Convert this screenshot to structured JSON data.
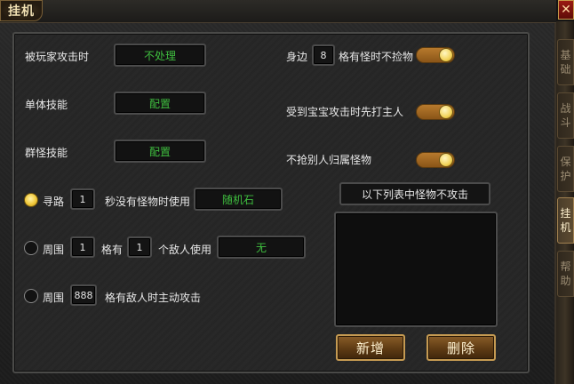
{
  "window": {
    "title": "挂机"
  },
  "settings": {
    "attacked_label": "被玩家攻击时",
    "attacked_value": "不处理",
    "single_skill_label": "单体技能",
    "single_skill_value": "配置",
    "group_skill_label": "群怪技能",
    "group_skill_value": "配置"
  },
  "right_options": {
    "nearby_prefix": "身边",
    "nearby_count": "8",
    "nearby_suffix": "格有怪时不捡物",
    "nearby_toggle": true,
    "pet_attacked_label": "受到宝宝攻击时先打主人",
    "pet_attacked_toggle": true,
    "no_steal_label": "不抢别人归属怪物",
    "no_steal_toggle": true
  },
  "pathfind": {
    "selected": true,
    "label": "寻路",
    "seconds": "1",
    "suffix": "秒没有怪物时使用",
    "item": "随机石"
  },
  "surround": {
    "selected": false,
    "label": "周围",
    "cells": "1",
    "mid": "格有",
    "enemies": "1",
    "suffix": "个敌人使用",
    "item": "无"
  },
  "auto_attack": {
    "selected": false,
    "label": "周围",
    "cells": "888",
    "suffix": "格有敌人时主动攻击"
  },
  "monster_list": {
    "header": "以下列表中怪物不攻击",
    "items": []
  },
  "buttons": {
    "add": "新增",
    "delete": "删除"
  },
  "side_tabs": [
    {
      "label": "基础",
      "chars": [
        "基",
        "础"
      ],
      "active": false
    },
    {
      "label": "战斗",
      "chars": [
        "战",
        "斗"
      ],
      "active": false
    },
    {
      "label": "保护",
      "chars": [
        "保",
        "护"
      ],
      "active": false
    },
    {
      "label": "挂机",
      "chars": [
        "挂",
        "机"
      ],
      "active": true
    },
    {
      "label": "帮助",
      "chars": [
        "帮",
        "助"
      ],
      "active": false
    }
  ],
  "close_glyph": "✕",
  "colors": {
    "value_green": "#3fbf3f",
    "toggle_on": "#b77a2d",
    "button_border": "#c59a52"
  }
}
